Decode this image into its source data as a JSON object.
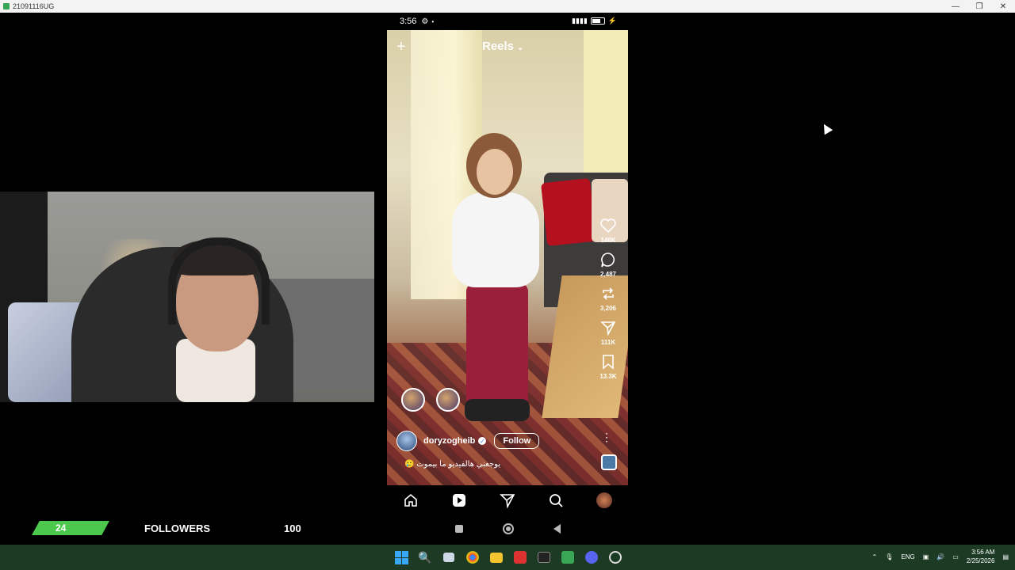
{
  "window": {
    "title": "21091116UG",
    "minimize": "—",
    "maximize": "❐",
    "close": "✕"
  },
  "phone": {
    "status": {
      "time": "3:56",
      "gear": "⚙",
      "dot": "•",
      "signal": "▮▮▮▮",
      "wifi": "▾"
    },
    "header": {
      "title": "Reels",
      "plus": "+",
      "chevron": "⌄"
    },
    "actions": {
      "likes": "146K",
      "comments": "2,487",
      "reposts": "3,206",
      "shares": "111K",
      "saves": "13.3K"
    },
    "author": {
      "username": "doryzogheib",
      "verified_mark": "✓",
      "follow_label": "Follow"
    },
    "caption": "🥲 يوجعني هالفيديو ما بيموت",
    "more": "⋮"
  },
  "followers_goal": {
    "current": "24",
    "label": "FOLLOWERS",
    "target": "100",
    "progress_fraction": 0.24,
    "bar_color": "#4cc94c"
  },
  "taskbar": {
    "search": "🔍",
    "lang": "ENG",
    "time": "3:56 AM",
    "date": "2/25/2026",
    "tray_up": "⌃"
  }
}
